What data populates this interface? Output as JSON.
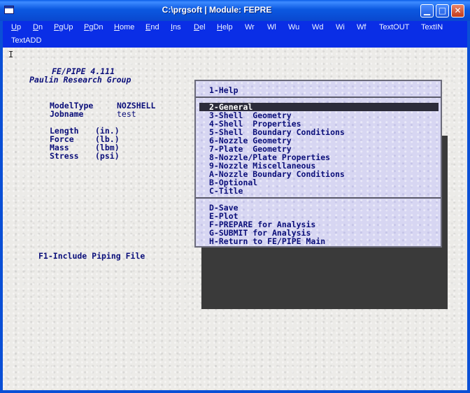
{
  "window": {
    "title": "C:\\prgsoft  |  Module: FEPRE"
  },
  "menubar": {
    "items": [
      {
        "key": "up",
        "text": "Up",
        "ul": "U",
        "rest": "p"
      },
      {
        "key": "dn",
        "text": "Dn",
        "ul": "D",
        "rest": "n"
      },
      {
        "key": "pgup",
        "text": "PgUp",
        "ul": "P",
        "rest": "gUp"
      },
      {
        "key": "pgdn",
        "text": "PgDn",
        "ul": "P",
        "rest": "gDn"
      },
      {
        "key": "home",
        "text": "Home",
        "ul": "H",
        "rest": "ome"
      },
      {
        "key": "end",
        "text": "End",
        "ul": "E",
        "rest": "nd"
      },
      {
        "key": "ins",
        "text": "Ins",
        "ul": "I",
        "rest": "ns"
      },
      {
        "key": "del",
        "text": "Del",
        "ul": "D",
        "rest": "el"
      },
      {
        "key": "help",
        "text": "Help",
        "ul": "H",
        "rest": "elp"
      },
      {
        "key": "wr",
        "text": "Wr",
        "ul": "",
        "rest": "Wr"
      },
      {
        "key": "wl",
        "text": "Wl",
        "ul": "",
        "rest": "Wl"
      },
      {
        "key": "wu",
        "text": "Wu",
        "ul": "",
        "rest": "Wu"
      },
      {
        "key": "wd",
        "text": "Wd",
        "ul": "",
        "rest": "Wd"
      },
      {
        "key": "wi",
        "text": "Wi",
        "ul": "",
        "rest": "Wi"
      },
      {
        "key": "wf",
        "text": "Wf",
        "ul": "",
        "rest": "Wf"
      },
      {
        "key": "textout",
        "text": "TextOUT",
        "ul": "",
        "rest": "TextOUT"
      },
      {
        "key": "textin",
        "text": "TextIN",
        "ul": "",
        "rest": "TextIN"
      },
      {
        "key": "textadd",
        "text": "TextADD",
        "ul": "",
        "rest": "TextADD"
      }
    ]
  },
  "header": {
    "program": "FE/PIPE 4.111",
    "organization": "Paulin Research Group"
  },
  "model": {
    "type_label": "ModelType",
    "type_value": "NOZSHELL",
    "jobname_label": "Jobname",
    "jobname_value": "test"
  },
  "units": [
    {
      "label": "Length",
      "unit": "(in.)"
    },
    {
      "label": "Force",
      "unit": "(lb.)"
    },
    {
      "label": "Mass",
      "unit": "(lbm)"
    },
    {
      "label": "Stress",
      "unit": "(psi)"
    }
  ],
  "footer_hint": "F1-Include Piping File",
  "menu": {
    "help": "1-Help",
    "options": [
      "2-General",
      "3-Shell  Geometry",
      "4-Shell  Properties",
      "5-Shell  Boundary Conditions",
      "6-Nozzle Geometry",
      "7-Plate  Geometry",
      "8-Nozzle/Plate Properties",
      "9-Nozzle Miscellaneous",
      "A-Nozzle Boundary Conditions",
      "B-Optional",
      "C-Title"
    ],
    "selected_index": 0,
    "actions": [
      "D-Save",
      "E-Plot",
      "F-PREPARE for Analysis",
      "G-SUBMIT for Analysis",
      "H-Return to FE/PIPE Main"
    ]
  }
}
